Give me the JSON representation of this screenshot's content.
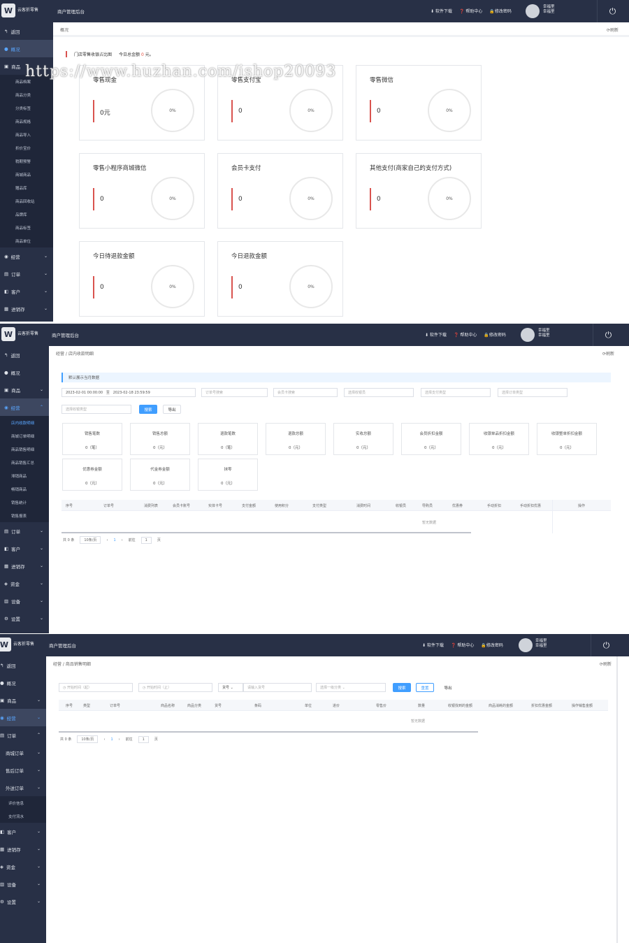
{
  "watermark": "https://www.huzhan.com/ishop20093",
  "shot1": {
    "topbar": {
      "title": "商户管理后台",
      "links": [
        "软件下载",
        "帮助中心",
        "修改密码"
      ],
      "user_name": "幸福里",
      "user_sub": "幸福里",
      "logo_text": "云客折零售"
    },
    "sidebar": [
      {
        "label": "返回",
        "icon": "↰"
      },
      {
        "label": "概况",
        "icon": "●",
        "active": true
      },
      {
        "label": "商品",
        "icon": "▣",
        "open": true
      }
    ],
    "subitems": [
      "商品档案",
      "商品分类",
      "分类标签",
      "商品规格",
      "商品导入",
      "折价宝价",
      "稍期预警",
      "商城商品",
      "赠品库",
      "商品回收站",
      "品牌库",
      "商品标签",
      "商品单位"
    ],
    "sidebar_bottom": [
      {
        "label": "经营",
        "icon": "◉"
      },
      {
        "label": "订单",
        "icon": "▤"
      },
      {
        "label": "客户",
        "icon": "◧"
      },
      {
        "label": "进销存",
        "icon": "▦"
      }
    ],
    "breadcrumb": "概况",
    "refresh": "刷新",
    "header_label": "门店零售收银占比图",
    "total_label": "今日总金额",
    "total_value": "0",
    "total_unit": "元。",
    "cards": [
      {
        "name": "零售现金",
        "value": "0元",
        "pct": "0%"
      },
      {
        "name": "零售支付宝",
        "value": "0",
        "pct": "0%"
      },
      {
        "name": "零售微信",
        "value": "0",
        "pct": "0%"
      },
      {
        "name": "零售小程序商城微信",
        "value": "0",
        "pct": "0%"
      },
      {
        "name": "会员卡支付",
        "value": "0",
        "pct": "0%"
      },
      {
        "name": "其他支付(商家自己的支付方式)",
        "value": "0",
        "pct": "0%"
      },
      {
        "name": "今日待退款金额",
        "value": "0",
        "pct": "0%"
      },
      {
        "name": "今日退款金额",
        "value": "0",
        "pct": "0%"
      }
    ]
  },
  "shot2": {
    "topbar": {
      "title": "商户管理后台",
      "links": [
        "软件下载",
        "帮助中心",
        "修改密码"
      ],
      "user_name": "幸福里",
      "user_sub": "幸福里",
      "logo_text": "云客折零售"
    },
    "sidebar": [
      {
        "label": "返回",
        "icon": "↰"
      },
      {
        "label": "概况",
        "icon": "●"
      },
      {
        "label": "商品",
        "icon": "▣",
        "chev": "⌄"
      },
      {
        "label": "经营",
        "icon": "◉",
        "chev": "⌃",
        "active": true
      }
    ],
    "subitems": [
      "店内收款明细",
      "商城订单明细",
      "商品销售明细",
      "商品销售汇总",
      "滞销商品",
      "畅销商品",
      "销售统计",
      "销售报表"
    ],
    "sidebar_bottom": [
      {
        "label": "订单",
        "icon": "▤"
      },
      {
        "label": "客户",
        "icon": "◧"
      },
      {
        "label": "进销存",
        "icon": "▦"
      },
      {
        "label": "资金",
        "icon": "◈"
      },
      {
        "label": "设备",
        "icon": "▥"
      },
      {
        "label": "设置",
        "icon": "⚙"
      }
    ],
    "breadcrumb": [
      "经营",
      "店内收款明细"
    ],
    "refresh": "刷新",
    "banner": "默认展示当月数据",
    "date_start": "2023-02-01 00:00:00",
    "date_sep": "至",
    "date_end": "2023-02-18 23:59:59",
    "filters": [
      "订单号搜索",
      "会员卡搜索",
      "选择收银员",
      "选择支付类型",
      "选择订单类型"
    ],
    "filter_extra": "选择收银类型",
    "search_btn": "搜索",
    "export_btn": "导出",
    "stats": [
      {
        "label": "销售笔数",
        "value": "0（笔）"
      },
      {
        "label": "销售总额",
        "value": "0（元）"
      },
      {
        "label": "退款笔数",
        "value": "0（笔）"
      },
      {
        "label": "退款总额",
        "value": "0（元）"
      },
      {
        "label": "实收总额",
        "value": "0（元）"
      },
      {
        "label": "会员折扣金额",
        "value": "0（元）"
      },
      {
        "label": "收银单品折扣金额",
        "value": "0（元）"
      },
      {
        "label": "收银整单折扣金额",
        "value": "0（元）"
      },
      {
        "label": "优惠券金额",
        "value": "0（元）"
      },
      {
        "label": "代金券金额",
        "value": "0（元）"
      },
      {
        "label": "抹零",
        "value": "0（元）"
      }
    ],
    "columns": [
      "序号",
      "订单号",
      "消费列表",
      "会员卡账号",
      "实体卡号",
      "支付金额",
      "使用积分",
      "支付类型",
      "消费时间",
      "收银员",
      "导购员",
      "优惠券",
      "手动折扣",
      "手动折扣优惠",
      "操作"
    ],
    "empty": "暂无数据",
    "pager": {
      "total": "共 0 条",
      "size": "10条/页",
      "prev": "‹",
      "page": "1",
      "next": "›",
      "goto": "前往",
      "goto_val": "1",
      "page_unit": "页"
    }
  },
  "shot3": {
    "topbar": {
      "title": "商户管理后台",
      "links": [
        "软件下载",
        "帮助中心",
        "修改密码"
      ],
      "user_name": "幸福里",
      "user_sub": "幸福里",
      "logo_text": "云客折零售"
    },
    "sidebar": [
      {
        "label": "返回",
        "icon": "↰"
      },
      {
        "label": "概况",
        "icon": "●"
      },
      {
        "label": "商品",
        "icon": "▣",
        "chev": "⌄"
      },
      {
        "label": "经营",
        "icon": "◉",
        "chev": "⌄",
        "active": true
      },
      {
        "label": "订单",
        "icon": "▤",
        "chev": "⌃"
      },
      {
        "label": "商城订单",
        "icon": "",
        "chev": "⌄"
      },
      {
        "label": "售后订单",
        "icon": "",
        "chev": "⌄"
      },
      {
        "label": "外送订单",
        "icon": "",
        "chev": "⌄"
      }
    ],
    "subitems": [
      "评价信息",
      "支付流水"
    ],
    "sidebar_bottom": [
      {
        "label": "客户",
        "icon": "◧"
      },
      {
        "label": "进销存",
        "icon": "▦"
      },
      {
        "label": "资金",
        "icon": "◈"
      },
      {
        "label": "设备",
        "icon": "▥"
      },
      {
        "label": "设置",
        "icon": "⚙"
      }
    ],
    "breadcrumb": [
      "经营",
      "商品销售明细"
    ],
    "refresh": "刷新",
    "filters": [
      "开始时间（起）",
      "开始时间（止）"
    ],
    "select_label": "货号",
    "goods_input": "请输入货号",
    "category": "选择一级分类",
    "search_btn": "搜索",
    "reset_btn": "重置",
    "export_btn": "导出",
    "columns": [
      "序号",
      "类型",
      "订单号",
      "商品名称",
      "商品分类",
      "货号",
      "条码",
      "单位",
      "进价",
      "零售价",
      "数量",
      "收银找到的金额",
      "商品消耗的金额",
      "折扣优惠金额",
      "操作销售金额"
    ],
    "empty": "暂无数据",
    "pager": {
      "total": "共 0 条",
      "size": "10条/页",
      "prev": "‹",
      "page": "1",
      "next": "›",
      "goto": "前往",
      "goto_val": "1",
      "page_unit": "页"
    }
  }
}
